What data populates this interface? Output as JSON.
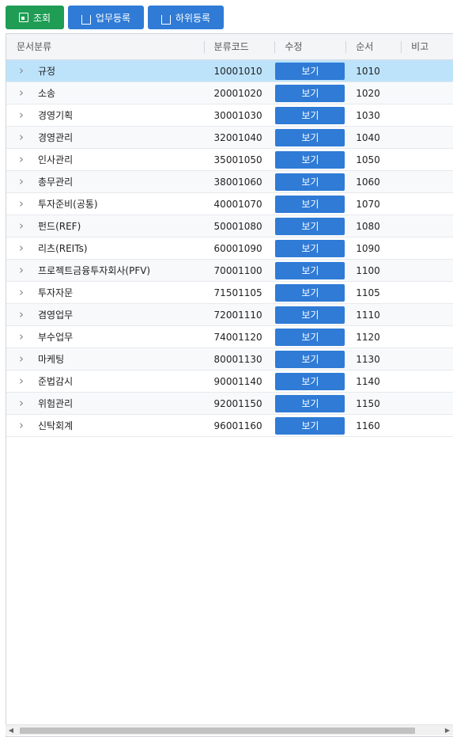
{
  "toolbar": {
    "search_label": "조회",
    "add_task_label": "업무등록",
    "add_sub_label": "하위등록"
  },
  "colors": {
    "search_button": "#1f9d55",
    "action_button": "#2f7bd6",
    "selected_row": "#bde3fb"
  },
  "grid": {
    "columns": [
      "문서분류",
      "분류코드",
      "수정",
      "순서",
      "비고"
    ],
    "rows": [
      {
        "name": "규정",
        "code": "10001010",
        "action": "보기",
        "order": "1010",
        "note": ""
      },
      {
        "name": "소송",
        "code": "20001020",
        "action": "보기",
        "order": "1020",
        "note": ""
      },
      {
        "name": "경영기획",
        "code": "30001030",
        "action": "보기",
        "order": "1030",
        "note": ""
      },
      {
        "name": "경영관리",
        "code": "32001040",
        "action": "보기",
        "order": "1040",
        "note": ""
      },
      {
        "name": "인사관리",
        "code": "35001050",
        "action": "보기",
        "order": "1050",
        "note": ""
      },
      {
        "name": "총무관리",
        "code": "38001060",
        "action": "보기",
        "order": "1060",
        "note": ""
      },
      {
        "name": "투자준비(공통)",
        "code": "40001070",
        "action": "보기",
        "order": "1070",
        "note": ""
      },
      {
        "name": "펀드(REF)",
        "code": "50001080",
        "action": "보기",
        "order": "1080",
        "note": ""
      },
      {
        "name": "리츠(REITs)",
        "code": "60001090",
        "action": "보기",
        "order": "1090",
        "note": ""
      },
      {
        "name": "프로젝트금융투자회사(PFV)",
        "code": "70001100",
        "action": "보기",
        "order": "1100",
        "note": ""
      },
      {
        "name": "투자자문",
        "code": "71501105",
        "action": "보기",
        "order": "1105",
        "note": ""
      },
      {
        "name": "겸영업무",
        "code": "72001110",
        "action": "보기",
        "order": "1110",
        "note": ""
      },
      {
        "name": "부수업무",
        "code": "74001120",
        "action": "보기",
        "order": "1120",
        "note": ""
      },
      {
        "name": "마케팅",
        "code": "80001130",
        "action": "보기",
        "order": "1130",
        "note": ""
      },
      {
        "name": "준법감시",
        "code": "90001140",
        "action": "보기",
        "order": "1140",
        "note": ""
      },
      {
        "name": "위험관리",
        "code": "92001150",
        "action": "보기",
        "order": "1150",
        "note": ""
      },
      {
        "name": "신탁회계",
        "code": "96001160",
        "action": "보기",
        "order": "1160",
        "note": ""
      }
    ]
  }
}
